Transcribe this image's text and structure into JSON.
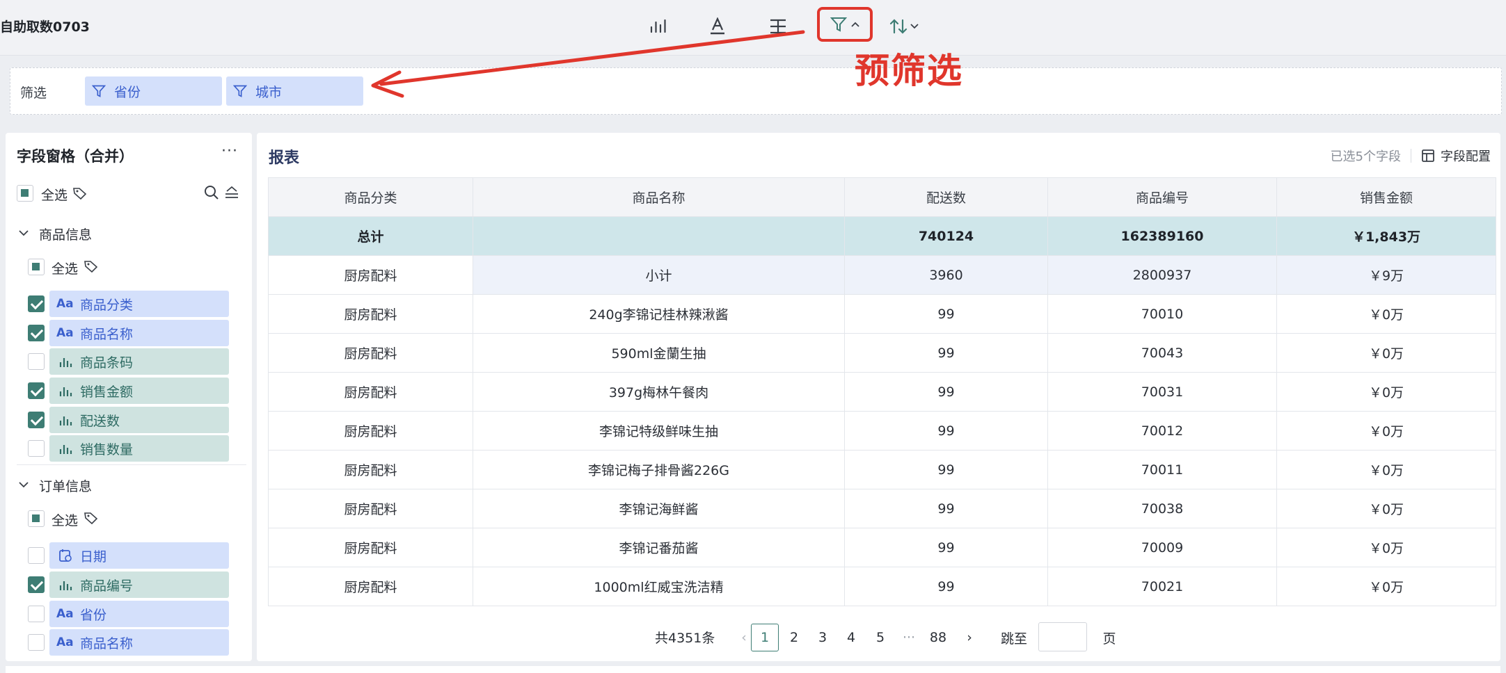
{
  "app": {
    "title": "自助取数0703"
  },
  "toolbar": {
    "icons": [
      "bar-chart-icon",
      "text-style-icon",
      "align-icon",
      "filter-icon",
      "sort-icon"
    ]
  },
  "annotation": {
    "text": "预筛选",
    "color": "#e0362c"
  },
  "filterbar": {
    "label": "筛选",
    "chips": [
      "省份",
      "城市"
    ]
  },
  "left_panel": {
    "title": "字段窗格（合并）",
    "more": "···",
    "select_all": "全选",
    "groups": [
      {
        "name": "商品信息",
        "select_all": "全选",
        "fields": [
          {
            "icon": "Aa",
            "label": "商品分类",
            "checked": true
          },
          {
            "icon": "bar",
            "label": "商品名称",
            "checked": true
          },
          {
            "icon": "bar",
            "label": "商品条码",
            "checked": false
          },
          {
            "icon": "bar",
            "label": "销售金额",
            "checked": true
          },
          {
            "icon": "bar",
            "label": "配送数",
            "checked": true
          },
          {
            "icon": "bar",
            "label": "销售数量",
            "checked": false
          }
        ]
      },
      {
        "name": "订单信息",
        "select_all": "全选",
        "fields": [
          {
            "icon": "date",
            "label": "日期",
            "checked": false
          },
          {
            "icon": "bar",
            "label": "商品编号",
            "checked": true
          },
          {
            "icon": "Aa",
            "label": "省份",
            "checked": false
          },
          {
            "icon": "Aa",
            "label": "商品名称",
            "checked": false
          }
        ]
      }
    ]
  },
  "report": {
    "title": "报表",
    "selected_fields": "已选5个字段",
    "config": "字段配置",
    "columns": [
      "商品分类",
      "商品名称",
      "配送数",
      "商品编号",
      "销售金额"
    ],
    "total": [
      "总计",
      "",
      "740124",
      "162389160",
      "￥1,843万"
    ],
    "subtotal": [
      "厨房配料",
      "小计",
      "3960",
      "2800937",
      "￥9万"
    ],
    "rows": [
      [
        "厨房配料",
        "240g李锦记桂林辣湫酱",
        "99",
        "70010",
        "￥0万"
      ],
      [
        "厨房配料",
        "590ml金蘭生抽",
        "99",
        "70043",
        "￥0万"
      ],
      [
        "厨房配料",
        "397g梅林午餐肉",
        "99",
        "70031",
        "￥0万"
      ],
      [
        "厨房配料",
        "李锦记特级鲜味生抽",
        "99",
        "70012",
        "￥0万"
      ],
      [
        "厨房配料",
        "李锦记梅子排骨酱226G",
        "99",
        "70011",
        "￥0万"
      ],
      [
        "厨房配料",
        "李锦记海鲜酱",
        "99",
        "70038",
        "￥0万"
      ],
      [
        "厨房配料",
        "李锦记番茄酱",
        "99",
        "70009",
        "￥0万"
      ],
      [
        "厨房配料",
        "1000ml红威宝洗洁精",
        "99",
        "70021",
        "￥0万"
      ]
    ]
  },
  "pager": {
    "total": "共4351条",
    "prev": "‹",
    "pages": [
      "1",
      "2",
      "3",
      "4",
      "5",
      "···",
      "88"
    ],
    "active": "1",
    "next": "›",
    "jump_label": "跳至",
    "page_label": "页"
  }
}
